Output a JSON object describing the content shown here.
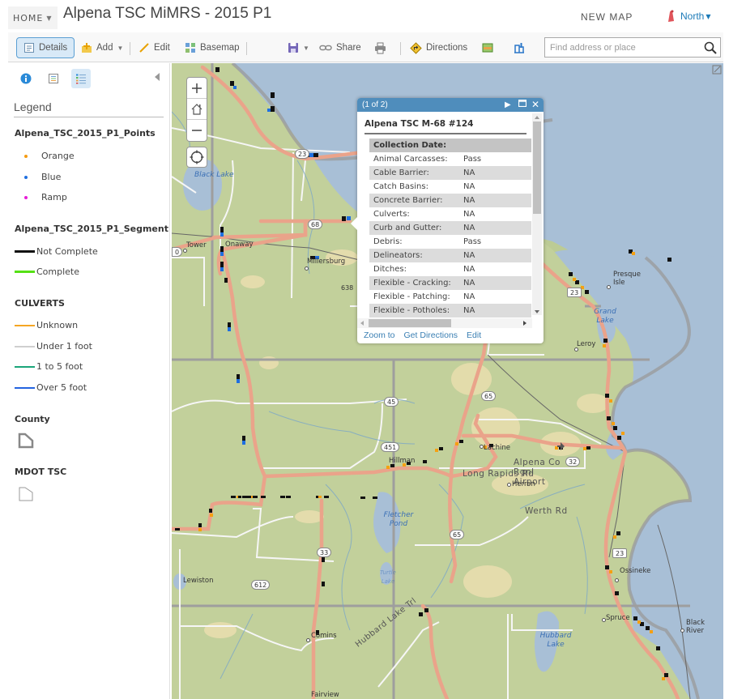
{
  "header": {
    "home_label": "HOME",
    "title": "Alpena TSC MiMRS - 2015 P1",
    "new_map_label": "NEW MAP",
    "user_name": "North"
  },
  "toolbar": {
    "details_label": "Details",
    "add_label": "Add",
    "edit_label": "Edit",
    "basemap_label": "Basemap",
    "share_label": "Share",
    "directions_label": "Directions",
    "search_placeholder": "Find address or place"
  },
  "left_panel": {
    "tabs": [
      "About",
      "Content",
      "Legend"
    ],
    "active_tab": "Legend",
    "legend_title": "Legend",
    "layers": [
      {
        "name": "Alpena_TSC_2015_P1_Points",
        "items": [
          {
            "label": "Orange",
            "color": "#f59b12"
          },
          {
            "label": "Blue",
            "color": "#1f6fe0"
          },
          {
            "label": "Ramp",
            "color": "#e81cd7"
          }
        ]
      },
      {
        "name": "Alpena_TSC_2015_P1_Segment",
        "items": [
          {
            "label": "Not Complete",
            "color": "#111111"
          },
          {
            "label": "Complete",
            "color": "#55e014"
          }
        ]
      },
      {
        "name": "CULVERTS",
        "items": [
          {
            "label": "Unknown",
            "color": "#f5a623"
          },
          {
            "label": "Under 1 foot",
            "color": "#cfcfcf"
          },
          {
            "label": "1 to 5 foot",
            "color": "#1aa57a"
          },
          {
            "label": "Over 5 foot",
            "color": "#2463e0"
          }
        ]
      },
      {
        "name": "County"
      },
      {
        "name": "MDOT TSC"
      }
    ]
  },
  "map": {
    "labels": {
      "black_lake": "Black Lake",
      "tower": "Tower",
      "onaway": "Onaway",
      "millersburg": "Millersburg",
      "presque_isle": "Presque Isle",
      "grand_lake": "Grand Lake",
      "leroy": "Leroy",
      "long_rapids_rd": "Long Rapids Rd",
      "lachine": "Lachine",
      "hillman": "Hillman",
      "alpena_airport": "Alpena Co Rgnl Airport",
      "herron": "Herron",
      "werth_rd": "Werth Rd",
      "fletcher_pond": "Fletcher Pond",
      "turtle_lake": "Turtle Lake",
      "lewiston": "Lewiston",
      "comins": "Comins",
      "fairview": "Fairview",
      "hubbard_lake": "Hubbard Lake",
      "hubbard_lake_trl": "Hubbard Lake Trl",
      "spruce": "Spruce",
      "ossineke": "Ossineke",
      "black_river": "Black River"
    },
    "shields": {
      "us23_north": "23",
      "m68": "68",
      "m638": "638",
      "us23_mid": "23",
      "m45": "45",
      "m451": "451",
      "m65_north": "65",
      "m65_south": "65",
      "m32": "32",
      "m33": "33",
      "c612": "612",
      "us23_south": "23",
      "m_left": "0"
    }
  },
  "popup": {
    "pager": "(1 of 2)",
    "title": "Alpena TSC M-68 #124",
    "header_row": "Collection Date:",
    "rows": [
      {
        "field": "Animal Carcasses:",
        "value": "Pass"
      },
      {
        "field": "Cable Barrier:",
        "value": "NA"
      },
      {
        "field": "Catch Basins:",
        "value": "NA"
      },
      {
        "field": "Concrete Barrier:",
        "value": "NA"
      },
      {
        "field": "Culverts:",
        "value": "NA"
      },
      {
        "field": "Curb and Gutter:",
        "value": "NA"
      },
      {
        "field": "Debris:",
        "value": "Pass"
      },
      {
        "field": "Delineators:",
        "value": "NA"
      },
      {
        "field": "Ditches:",
        "value": "NA"
      },
      {
        "field": "Flexible - Cracking:",
        "value": "NA"
      },
      {
        "field": "Flexible - Patching:",
        "value": "NA"
      },
      {
        "field": "Flexible - Potholes:",
        "value": "NA"
      }
    ],
    "actions": {
      "zoom_to": "Zoom to",
      "get_directions": "Get Directions",
      "edit": "Edit"
    }
  }
}
